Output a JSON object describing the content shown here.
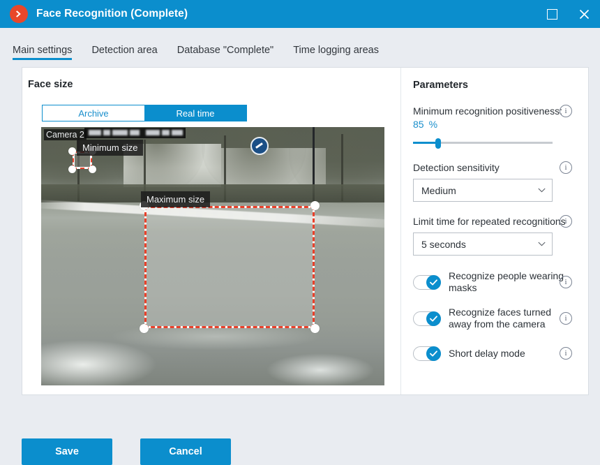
{
  "window": {
    "title": "Face Recognition (Complete)",
    "logo_icon": "chevron-right-circle-icon",
    "maximize_icon": "maximize-icon",
    "close_icon": "close-icon",
    "accent_color": "#0b8ecd",
    "logo_color": "#e8472a"
  },
  "tabs": [
    {
      "label": "Main settings",
      "active": true
    },
    {
      "label": "Detection area",
      "active": false
    },
    {
      "label": "Database \"Complete\"",
      "active": false
    },
    {
      "label": "Time logging areas",
      "active": false
    }
  ],
  "face_size": {
    "heading": "Face size",
    "segmented": {
      "options": [
        "Archive",
        "Real time"
      ],
      "selected": "Real time"
    },
    "preview": {
      "camera_label": "Camera 2",
      "min_size_tag": "Minimum size",
      "max_size_tag": "Maximum size",
      "selection_color": "#e8402a"
    }
  },
  "parameters": {
    "heading": "Parameters",
    "min_positiveness": {
      "label": "Minimum recognition positiveness:",
      "value": "85",
      "unit": "%",
      "slider_percent": 18,
      "info_icon": "info-icon"
    },
    "detection_sensitivity": {
      "label": "Detection sensitivity",
      "value": "Medium",
      "chevron_icon": "chevron-down-icon",
      "info_icon": "info-icon"
    },
    "limit_time": {
      "label": "Limit time for repeated recognitions",
      "value": "5 seconds",
      "chevron_icon": "chevron-down-icon",
      "info_icon": "info-icon"
    },
    "toggles": [
      {
        "label": "Recognize people wearing masks",
        "on": true,
        "icon": "check-icon",
        "info_icon": "info-icon"
      },
      {
        "label": "Recognize faces turned away from the camera",
        "on": true,
        "icon": "check-icon",
        "info_icon": "info-icon"
      },
      {
        "label": "Short delay mode",
        "on": true,
        "icon": "check-icon",
        "info_icon": "info-icon"
      }
    ]
  },
  "footer": {
    "save_label": "Save",
    "cancel_label": "Cancel"
  }
}
